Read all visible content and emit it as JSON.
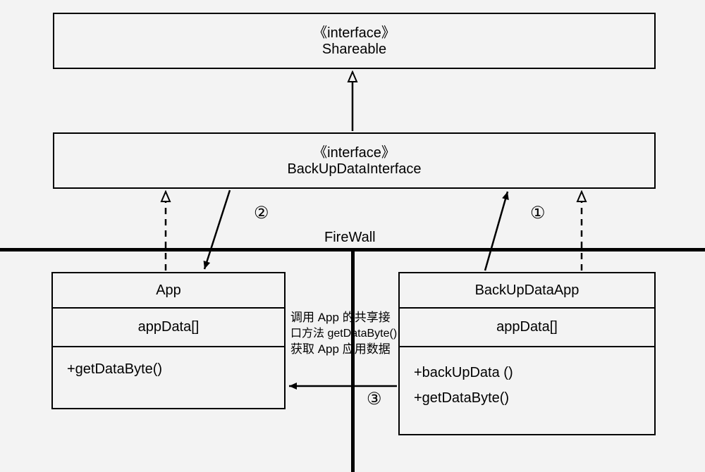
{
  "interfaces": {
    "shareable": {
      "stereotype": "《interface》",
      "name": "Shareable"
    },
    "backupInterface": {
      "stereotype": "《interface》",
      "name": "BackUpDataInterface"
    }
  },
  "firewall": {
    "label": "FireWall"
  },
  "classes": {
    "app": {
      "name": "App",
      "attribute": "appData[]",
      "method": "+getDataByte()"
    },
    "backupApp": {
      "name": "BackUpDataApp",
      "attribute": "appData[]",
      "method1": "+backUpData ()",
      "method2": "+getDataByte()"
    }
  },
  "note": {
    "line1": "调用 App 的共享接",
    "line2": "口方法 getDataByte()",
    "line3": "获取 App 应用数据"
  },
  "markers": {
    "m1": "①",
    "m2": "②",
    "m3": "③"
  }
}
